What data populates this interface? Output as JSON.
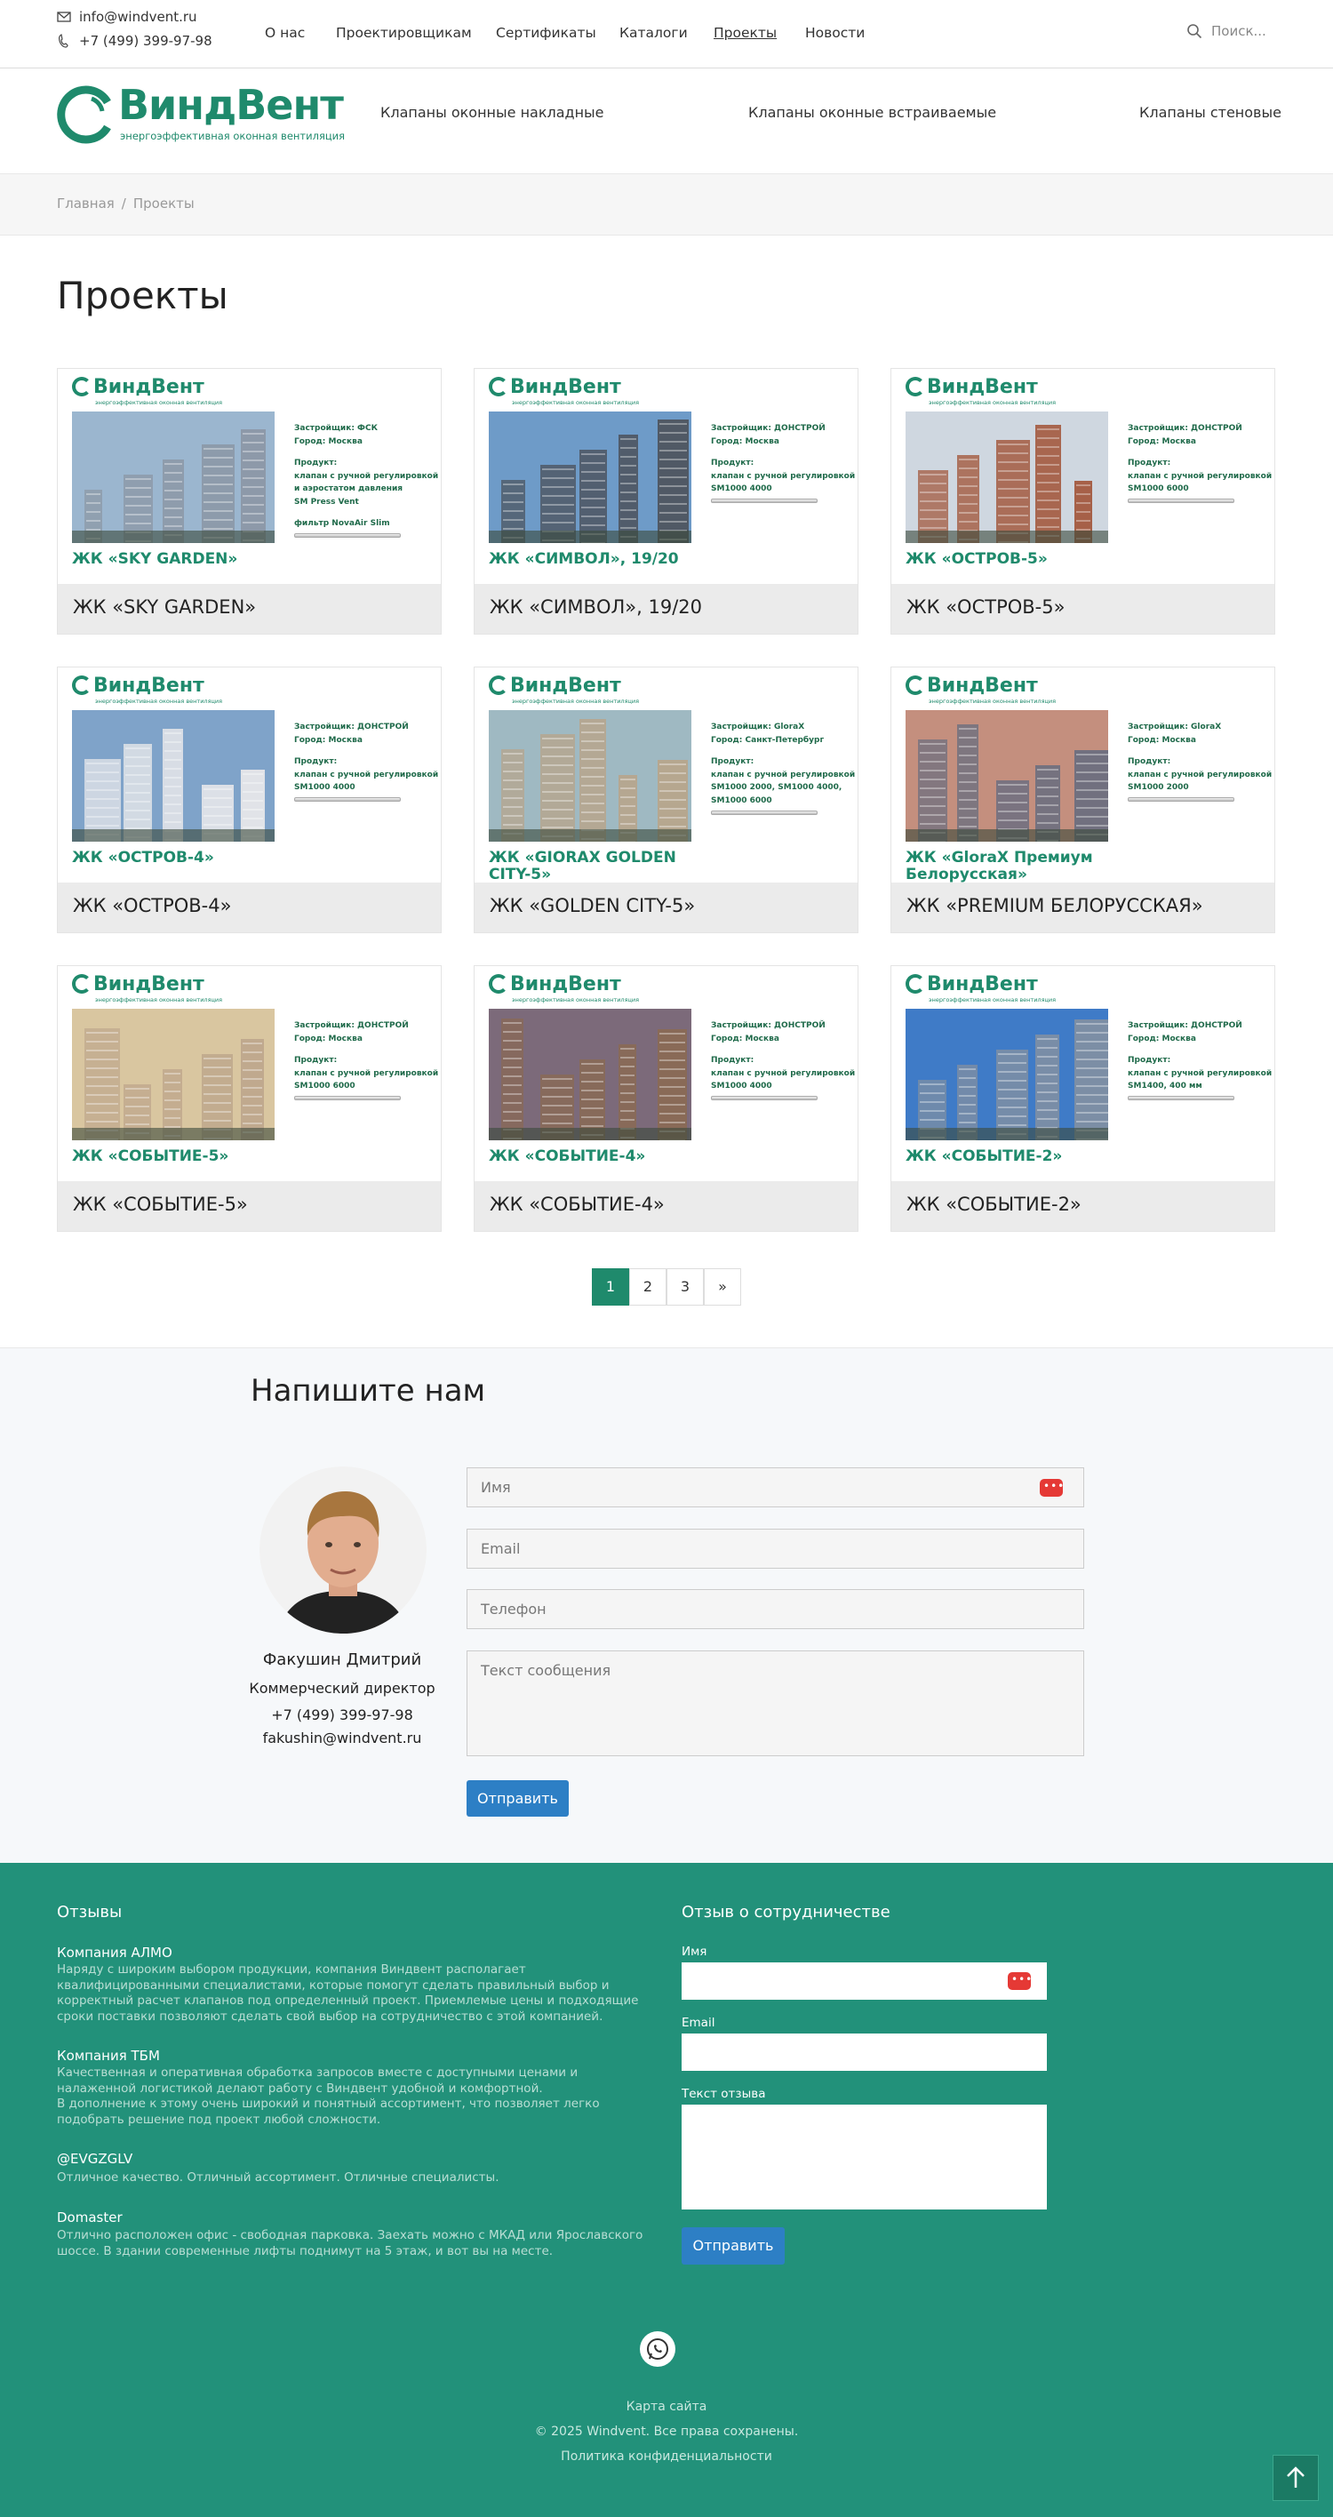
{
  "topbar": {
    "email": "info@windvent.ru",
    "phone": "+7 (499) 399-97-98",
    "nav": [
      "О нас",
      "Проектировщикам",
      "Сертификаты",
      "Каталоги",
      "Проекты",
      "Новости"
    ],
    "search_placeholder": "Поиск..."
  },
  "header": {
    "logo_name": "ВиндВент",
    "logo_tagline": "энергоэффективная оконная вентиляция",
    "products": [
      "Клапаны оконные накладные",
      "Клапаны оконные встраиваемые",
      "Клапаны стеновые"
    ]
  },
  "breadcrumb": [
    "Главная",
    "Проекты"
  ],
  "page_title": "Проекты",
  "projects": [
    {
      "caption": "ЖК «SKY GARDEN»",
      "title": "ЖК «SKY GARDEN»",
      "info": [
        "Застройщик: ФСК",
        "Город: Москва",
        "",
        "Продукт:",
        "клапан с ручной регулировкой и аэростатом давления",
        "SM Press Vent",
        "",
        "фильтр NovaAir Slim"
      ]
    },
    {
      "caption": "ЖК «СИМВОЛ», 19/20",
      "title": "ЖК «СИМВОЛ», 19/20",
      "info": [
        "Застройщик: ДОНСТРОЙ",
        "Город: Москва",
        "",
        "Продукт:",
        "клапан с ручной регулировкой",
        "SM1000 4000"
      ]
    },
    {
      "caption": "ЖК «ОСТРОВ-5»",
      "title": "ЖК «ОСТРОВ-5»",
      "info": [
        "Застройщик: ДОНСТРОЙ",
        "Город: Москва",
        "",
        "Продукт:",
        "клапан с ручной регулировкой",
        "SM1000 6000"
      ]
    },
    {
      "caption": "ЖК «ОСТРОВ-4»",
      "title": "ЖК «ОСТРОВ-4»",
      "info": [
        "Застройщик: ДОНСТРОЙ",
        "Город: Москва",
        "",
        "Продукт:",
        "клапан с ручной регулировкой",
        "SM1000 4000"
      ]
    },
    {
      "caption": "ЖК «GOLDEN CITY-5»",
      "title": "ЖК «GIORAX GOLDEN CITY-5»",
      "info": [
        "Застройщик: GloraX",
        "Город: Санкт-Петербург",
        "",
        "Продукт:",
        "клапан с ручной регулировкой",
        "SM1000 2000, SM1000 4000,",
        "SM1000 6000"
      ]
    },
    {
      "caption": "ЖК «PREMIUM БЕЛОРУССКАЯ»",
      "title": "ЖК «GloraX Премиум Белорусская»",
      "info": [
        "Застройщик: GloraX",
        "Город: Москва",
        "",
        "Продукт:",
        "клапан с ручной регулировкой",
        "SM1000 2000"
      ]
    },
    {
      "caption": "ЖК «СОБЫТИЕ-5»",
      "title": "ЖК «СОБЫТИЕ-5»",
      "info": [
        "Застройщик: ДОНСТРОЙ",
        "Город: Москва",
        "",
        "Продукт:",
        "клапан с ручной регулировкой",
        "SM1000 6000"
      ]
    },
    {
      "caption": "ЖК «СОБЫТИЕ-4»",
      "title": "ЖК «СОБЫТИЕ-4»",
      "info": [
        "Застройщик: ДОНСТРОЙ",
        "Город: Москва",
        "",
        "Продукт:",
        "клапан с ручной регулировкой",
        "SM1000 4000"
      ]
    },
    {
      "caption": "ЖК «СОБЫТИЕ-2»",
      "title": "ЖК «СОБЫТИЕ-2»",
      "info": [
        "Застройщик: ДОНСТРОЙ",
        "Город: Москва",
        "",
        "Продукт:",
        "клапан с ручной регулировкой",
        "SM1400, 400 мм"
      ]
    }
  ],
  "pagination": [
    "1",
    "2",
    "3",
    "»"
  ],
  "contact": {
    "heading": "Напишите нам",
    "name": "Факушин Дмитрий",
    "role": "Коммерческий директор",
    "phone": "+7 (499) 399-97-98",
    "email": "fakushin@windvent.ru",
    "fields": {
      "name": "Имя",
      "email": "Email",
      "phone": "Телефон",
      "message": "Текст сообщения"
    },
    "submit": "Отправить"
  },
  "footer": {
    "reviews_title": "Отзывы",
    "reviews": [
      {
        "author": "Компания АЛМО",
        "text": "Наряду с широким выбором продукции, компания Виндвент располагает квалифицированными специалистами, которые помогут сделать правильный выбор и корректный расчет клапанов под определенный проект. Приемлемые цены и подходящие сроки поставки позволяют сделать свой выбор на сотрудничество с этой компанией."
      },
      {
        "author": "Компания ТБМ",
        "text": "Качественная и оперативная обработка запросов вместе с доступными ценами и налаженной логистикой делают работу с Виндвент удобной и комфортной.\nВ дополнение к этому очень широкий и понятный ассортимент, что позволяет легко подобрать решение под проект любой сложности."
      },
      {
        "author": "@EVGZGLV",
        "text": "Отличное качество. Отличный ассортимент. Отличные специалисты."
      },
      {
        "author": "Domaster",
        "text": "Отлично расположен офис - свободная парковка. Заехать можно с МКАД или Ярославского шоссе. В здании современные лифты поднимут на 5 этаж, и вот вы на месте."
      }
    ],
    "feedback_title": "Отзыв о сотрудничестве",
    "feedback_fields": {
      "name": "Имя",
      "email": "Email",
      "text": "Текст отзыва"
    },
    "feedback_submit": "Отправить",
    "sitemap": "Карта сайта",
    "copyright": "© 2025 Windvent. Все права сохранены.",
    "privacy": "Политика конфиденциальности"
  },
  "colors": {
    "brand": "#1f8a6c",
    "footer": "#22917a",
    "button": "#2d7fc5"
  }
}
